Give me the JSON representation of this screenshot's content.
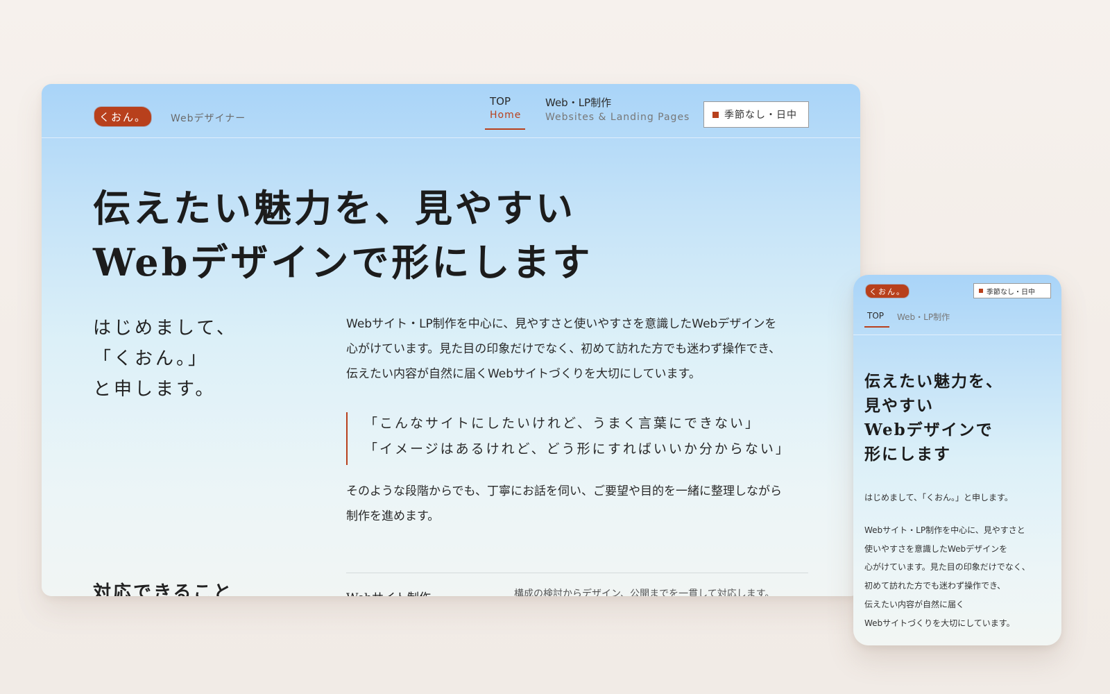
{
  "desktop": {
    "logo": "くおん。",
    "role": "Webデザイナー",
    "nav": [
      {
        "label": "TOP",
        "sub": "Home"
      },
      {
        "label": "Web・LP制作",
        "sub": "Websites & Landing Pages"
      }
    ],
    "season_button": "季節なし・日中",
    "hero_lines": [
      "伝えたい魅力を、見やすい",
      "Webデザインで形にします"
    ],
    "intro_lines": [
      "はじめまして、",
      "「くおん。」",
      "と申します。"
    ],
    "paragraph1": [
      "Webサイト・LP制作を中心に、見やすさと使いやすさを意識したWebデザインを",
      "心がけています。見た目の印象だけでなく、初めて訪れた方でも迷わず操作でき、",
      "伝えたい内容が自然に届くWebサイトづくりを大切にしています。"
    ],
    "quotes": [
      "「こんなサイトにしたいけれど、うまく言葉にできない」",
      "「イメージはあるけれど、どう形にすればいいか分からない」"
    ],
    "paragraph2": [
      "そのような段階からでも、丁寧にお話を伺い、ご要望や目的を一緒に整理しながら",
      "制作を進めます。"
    ],
    "section_title": "対応できること",
    "services": [
      {
        "name": "Webサイト制作",
        "desc": "構成の検討からデザイン、公開までを一貫して対応します。"
      }
    ]
  },
  "mobile": {
    "logo": "くおん。",
    "season_button": "季節なし・日中",
    "nav": [
      "TOP",
      "Web・LP制作"
    ],
    "hero_lines": [
      "伝えたい魅力を、",
      "見やすい",
      "Webデザインで",
      "形にします"
    ],
    "intro": "はじめまして、「くおん。」と申します。",
    "body_lines": [
      "Webサイト・LP制作を中心に、見やすさと",
      "使いやすさを意識したWebデザインを",
      "心がけています。見た目の印象だけでなく、",
      "初めて訪れた方でも迷わず操作でき、",
      "伝えたい内容が自然に届く",
      "Webサイトづくりを大切にしています。"
    ]
  },
  "colors": {
    "accent": "#b8401c",
    "sky_top": "#a9d4f8",
    "background": "#f4eee9"
  },
  "icons": [
    "square-marker-icon"
  ]
}
